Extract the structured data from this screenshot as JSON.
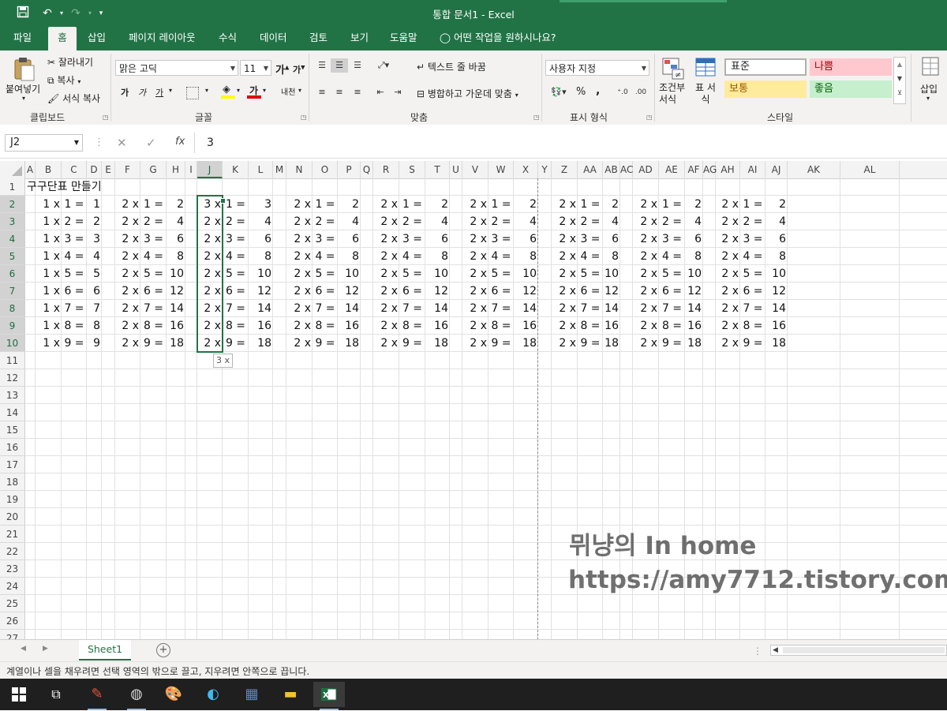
{
  "window": {
    "title": "통합 문서1  -  Excel"
  },
  "ribbon_tabs": [
    "파일",
    "홈",
    "삽입",
    "페이지 레이아웃",
    "수식",
    "데이터",
    "검토",
    "보기",
    "도움말",
    "어떤 작업을 원하시나요?"
  ],
  "ribbon": {
    "paste": "붙여넣기",
    "cut": "잘라내기",
    "copy": "복사",
    "format_painter": "서식 복사",
    "clipboard_label": "클립보드",
    "font_name": "맑은 고딕",
    "font_size": "11",
    "font_label": "글꼴",
    "wrap_text": "텍스트 줄 바꿈",
    "merge_center": "병합하고 가운데 맞춤",
    "alignment_label": "맞춤",
    "number_format": "사용자 지정",
    "number_label": "표시 형식",
    "conditional_format": "조건부 서식",
    "table_format": "표 서식",
    "style_label": "스타일",
    "styles": [
      "표준",
      "나쁨",
      "보통",
      "좋음"
    ],
    "insert": "삽입",
    "bold": "가",
    "italic": "가",
    "underline": "가",
    "grow_font": "가",
    "shrink_font": "가",
    "phonetic": "내천",
    "percent": "%",
    "comma": ","
  },
  "formula_bar": {
    "name_box": "J2",
    "formula": "3",
    "fx": "fx"
  },
  "columns": [
    "A",
    "B",
    "C",
    "D",
    "E",
    "F",
    "G",
    "H",
    "I",
    "J",
    "K",
    "L",
    "M",
    "N",
    "O",
    "P",
    "Q",
    "R",
    "S",
    "T",
    "U",
    "V",
    "W",
    "X",
    "Y",
    "Z",
    "AA",
    "AB",
    "AC",
    "AD",
    "AE",
    "AF",
    "AG",
    "AH",
    "AI",
    "AJ",
    "AK",
    "AL"
  ],
  "rows": [
    "1",
    "2",
    "3",
    "4",
    "5",
    "6",
    "7",
    "8",
    "9",
    "10",
    "11",
    "12",
    "13",
    "14",
    "15",
    "16",
    "17",
    "18",
    "19",
    "20",
    "21",
    "22",
    "23",
    "24",
    "25",
    "26",
    "27"
  ],
  "sheet": {
    "title_cell": "구구단표 만들기",
    "rows": [
      [
        "1 x",
        "1 =",
        "1",
        "2 x",
        "1 =",
        "2",
        "3 x",
        "1 =",
        "3",
        "2 x",
        "1 =",
        "2",
        "2 x",
        "1 =",
        "2",
        "2 x",
        "1 =",
        "2",
        "2 x",
        "1 =",
        "2",
        "2 x",
        "1 =",
        "2",
        "2 x",
        "1 =",
        "2"
      ],
      [
        "1 x",
        "2 =",
        "2",
        "2 x",
        "2 =",
        "4",
        "2 x",
        "2 =",
        "4",
        "2 x",
        "2 =",
        "4",
        "2 x",
        "2 =",
        "4",
        "2 x",
        "2 =",
        "4",
        "2 x",
        "2 =",
        "4",
        "2 x",
        "2 =",
        "4",
        "2 x",
        "2 =",
        "4"
      ],
      [
        "1 x",
        "3 =",
        "3",
        "2 x",
        "3 =",
        "6",
        "2 x",
        "3 =",
        "6",
        "2 x",
        "3 =",
        "6",
        "2 x",
        "3 =",
        "6",
        "2 x",
        "3 =",
        "6",
        "2 x",
        "3 =",
        "6",
        "2 x",
        "3 =",
        "6",
        "2 x",
        "3 =",
        "6"
      ],
      [
        "1 x",
        "4 =",
        "4",
        "2 x",
        "4 =",
        "8",
        "2 x",
        "4 =",
        "8",
        "2 x",
        "4 =",
        "8",
        "2 x",
        "4 =",
        "8",
        "2 x",
        "4 =",
        "8",
        "2 x",
        "4 =",
        "8",
        "2 x",
        "4 =",
        "8",
        "2 x",
        "4 =",
        "8"
      ],
      [
        "1 x",
        "5 =",
        "5",
        "2 x",
        "5 =",
        "10",
        "2 x",
        "5 =",
        "10",
        "2 x",
        "5 =",
        "10",
        "2 x",
        "5 =",
        "10",
        "2 x",
        "5 =",
        "10",
        "2 x",
        "5 =",
        "10",
        "2 x",
        "5 =",
        "10",
        "2 x",
        "5 =",
        "10"
      ],
      [
        "1 x",
        "6 =",
        "6",
        "2 x",
        "6 =",
        "12",
        "2 x",
        "6 =",
        "12",
        "2 x",
        "6 =",
        "12",
        "2 x",
        "6 =",
        "12",
        "2 x",
        "6 =",
        "12",
        "2 x",
        "6 =",
        "12",
        "2 x",
        "6 =",
        "12",
        "2 x",
        "6 =",
        "12"
      ],
      [
        "1 x",
        "7 =",
        "7",
        "2 x",
        "7 =",
        "14",
        "2 x",
        "7 =",
        "14",
        "2 x",
        "7 =",
        "14",
        "2 x",
        "7 =",
        "14",
        "2 x",
        "7 =",
        "14",
        "2 x",
        "7 =",
        "14",
        "2 x",
        "7 =",
        "14",
        "2 x",
        "7 =",
        "14"
      ],
      [
        "1 x",
        "8 =",
        "8",
        "2 x",
        "8 =",
        "16",
        "2 x",
        "8 =",
        "16",
        "2 x",
        "8 =",
        "16",
        "2 x",
        "8 =",
        "16",
        "2 x",
        "8 =",
        "16",
        "2 x",
        "8 =",
        "16",
        "2 x",
        "8 =",
        "16",
        "2 x",
        "8 =",
        "16"
      ],
      [
        "1 x",
        "9 =",
        "9",
        "2 x",
        "9 =",
        "18",
        "2 x",
        "9 =",
        "18",
        "2 x",
        "9 =",
        "18",
        "2 x",
        "9 =",
        "18",
        "2 x",
        "9 =",
        "18",
        "2 x",
        "9 =",
        "18",
        "2 x",
        "9 =",
        "18",
        "2 x",
        "9 =",
        "18"
      ]
    ],
    "fill_tooltip": "3 x",
    "watermark_line1": "뮈냥의 In home",
    "watermark_line2": "https://amy7712.tistory.com"
  },
  "sheet_tabs": [
    "Sheet1"
  ],
  "status_text": "계열이나 셀을 채우려면 선택 영역의 밖으로 끌고, 지우려면 안쪽으로 끕니다.",
  "taskbar_icons": [
    "windows-start-icon",
    "task-view-icon",
    "paint-app-icon",
    "photo-app-icon",
    "paint-palette-icon",
    "edge-browser-icon",
    "calculator-icon",
    "file-explorer-icon",
    "excel-icon"
  ],
  "colors": {
    "accent": "#217346",
    "bad_bg": "#ffc7ce",
    "neutral_bg": "#ffeb9c",
    "good_bg": "#c6efce"
  }
}
